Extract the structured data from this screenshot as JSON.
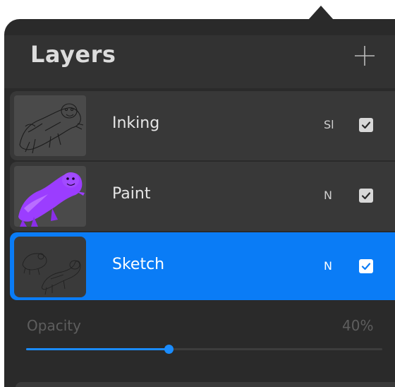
{
  "panel": {
    "title": "Layers",
    "add_icon": "plus-icon"
  },
  "layers": [
    {
      "name": "Inking",
      "blend_mode": "Sl",
      "visible": true,
      "selected": false,
      "thumbnail": "line-art-creature"
    },
    {
      "name": "Paint",
      "blend_mode": "N",
      "visible": true,
      "selected": false,
      "thumbnail": "purple-painted-creature"
    },
    {
      "name": "Sketch",
      "blend_mode": "N",
      "visible": true,
      "selected": true,
      "thumbnail": "rough-sketch-creatures"
    }
  ],
  "opacity": {
    "label": "Opacity",
    "value_text": "40%",
    "value": 0.4
  },
  "colors": {
    "panel_bg": "#2a2a2a",
    "row_bg": "#383838",
    "selected_row": "#0a7cf6",
    "slider_accent": "#1a8cff",
    "paint_purple": "#9b3dff"
  }
}
